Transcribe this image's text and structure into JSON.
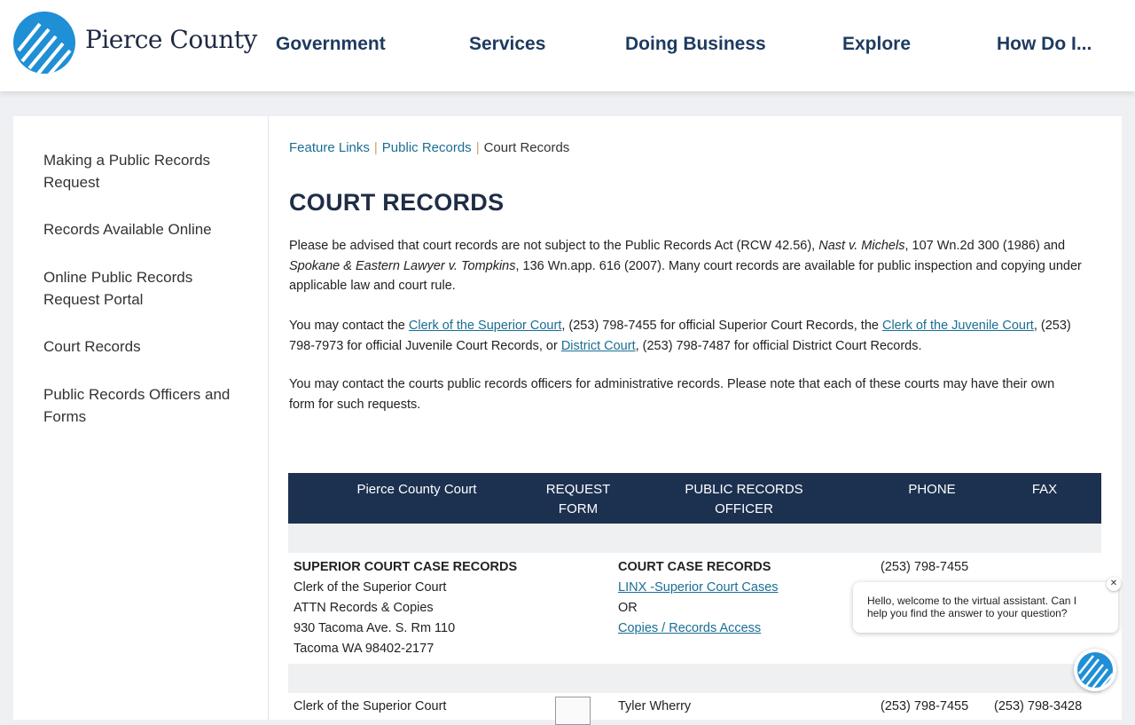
{
  "header": {
    "logo_text": "Pierce County",
    "nav": [
      "Government",
      "Services",
      "Doing Business",
      "Explore",
      "How Do I..."
    ]
  },
  "sidebar": {
    "items": [
      {
        "line1": "Making a Public Records",
        "line2": "Request"
      },
      {
        "line1": "Records Available Online",
        "line2": ""
      },
      {
        "line1": "Online Public Records",
        "line2": "Request Portal"
      },
      {
        "line1": "Court Records",
        "line2": ""
      },
      {
        "line1": "Public Records Officers and",
        "line2": "Forms"
      }
    ]
  },
  "breadcrumb": {
    "items": [
      "Feature Links",
      "Public Records",
      "Court Records"
    ],
    "separator": "|"
  },
  "page_title": "COURT RECORDS",
  "para1": {
    "t1": "Please be advised that court records are not subject to the Public Records Act (RCW 42.56), ",
    "i1": "Nast v. Michels",
    "t2": ", 107 Wn.2d 300 (1986) and",
    "i2": "Spokane & Eastern Lawyer v. Tompkins",
    "t3": ", 136 Wn.app. 616 (2007). Many court records are available for public inspection and copying under",
    "t4": "applicable law and court rule."
  },
  "para2": {
    "t1": "You may contact the ",
    "link1": "Clerk of the Superior Court",
    "t2": ", (253) 798-7455 for official Superior Court Records, the ",
    "link2": "Clerk of the Juvenile Court",
    "t3": ", (253)",
    "t4": "798-7973 for official Juvenile Court Records, or ",
    "link3": "District Court",
    "t5": ", (253) 798-7487 for official District Court Records."
  },
  "para3": {
    "line1": "You may contact the courts public records officers for administrative records. Please note that each of these courts may have their own",
    "line2": "form for such requests."
  },
  "table": {
    "headers": {
      "court": "Pierce County Court",
      "request_1": "REQUEST",
      "request_2": "FORM",
      "officer_1": "PUBLIC RECORDS",
      "officer_2": "OFFICER",
      "phone": "PHONE",
      "fax": "FAX"
    },
    "row1": {
      "court_title": "SUPERIOR COURT CASE RECORDS",
      "court_lines": [
        "Clerk of the Superior Court",
        "ATTN Records & Copies",
        "930 Tacoma Ave. S. Rm 110",
        "Tacoma WA  98402-2177"
      ],
      "officer_title": "COURT CASE RECORDS",
      "officer_link1": "LINX -Superior Court Cases",
      "officer_or": "OR",
      "officer_link2": "Copies / Records Access",
      "phone": "(253) 798-7455"
    },
    "row2": {
      "court": "Clerk of the Superior Court",
      "officer": "Tyler Wherry",
      "phone": "(253) 798-7455",
      "fax": "(253) 798-3428"
    }
  },
  "chat": {
    "message": "Hello, welcome to the virtual assistant. Can I help you find the answer to your question?",
    "close": "✕"
  },
  "colors": {
    "nav_text": "#1e3a5f",
    "link": "#1a6e94",
    "table_header": "#1c3150",
    "logo_blue": "#1f8fd6"
  }
}
